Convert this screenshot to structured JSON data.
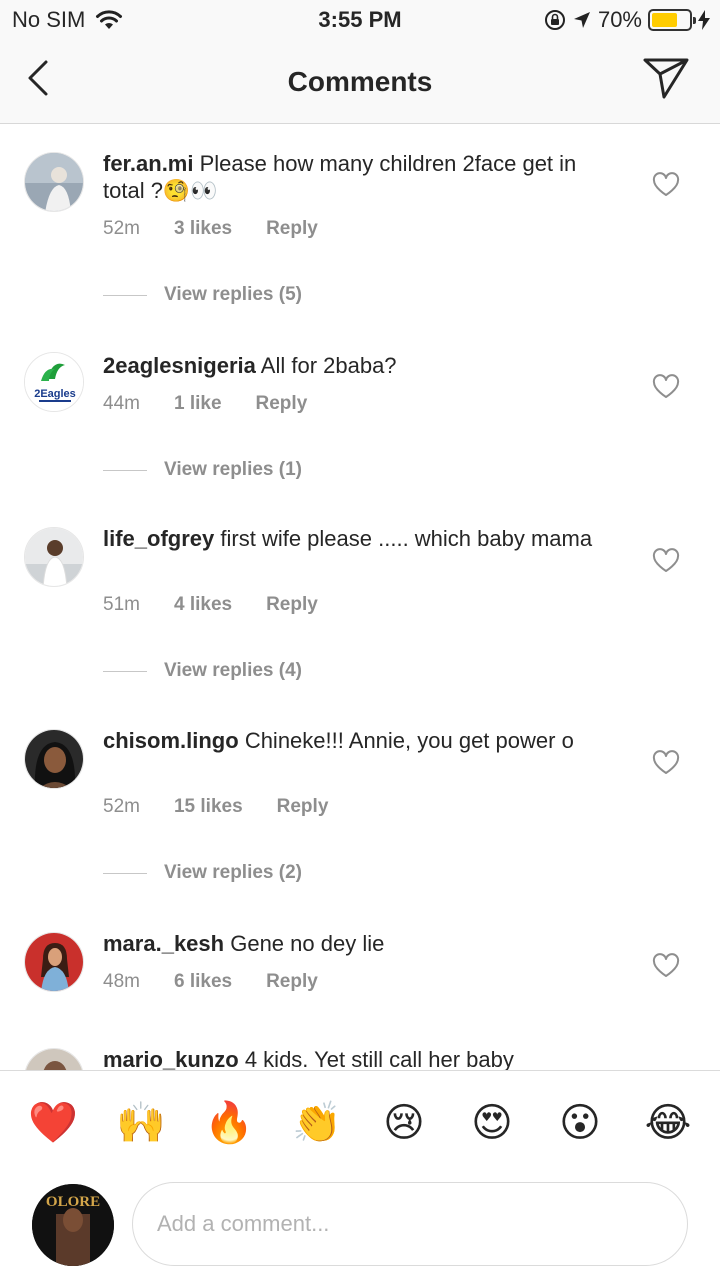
{
  "status_bar": {
    "carrier": "No SIM",
    "time": "3:55 PM",
    "battery_percent": "70%",
    "battery_level": 0.7
  },
  "nav": {
    "title": "Comments"
  },
  "comments": [
    {
      "username": "fer.an.mi",
      "text": "Please how many children 2face get in total ?🧐👀",
      "time": "52m",
      "likes": "3 likes",
      "reply": "Reply",
      "view_replies": "View replies (5)"
    },
    {
      "username": "2eaglesnigeria",
      "text": "All for 2baba?",
      "time": "44m",
      "likes": "1 like",
      "reply": "Reply",
      "view_replies": "View replies (1)",
      "avatar_logo_text": "2Eagles"
    },
    {
      "username": "life_ofgrey",
      "text": "first wife please ..... which baby mama",
      "time": "51m",
      "likes": "4 likes",
      "reply": "Reply",
      "view_replies": "View replies (4)"
    },
    {
      "username": "chisom.lingo",
      "text": "Chineke!!! Annie, you get power o",
      "time": "52m",
      "likes": "15 likes",
      "reply": "Reply",
      "view_replies": "View replies (2)"
    },
    {
      "username": "mara._kesh",
      "text": "Gene no dey lie",
      "time": "48m",
      "likes": "6 likes",
      "reply": "Reply"
    },
    {
      "username": "mario_kunzo",
      "text": "4 kids. Yet still call her baby"
    }
  ],
  "emoji_bar": [
    "❤️",
    "🙌",
    "🔥",
    "👏",
    "😢",
    "😍",
    "😮",
    "😂"
  ],
  "input": {
    "placeholder": "Add a comment..."
  },
  "my_avatar_text": "OLORE",
  "icons": {
    "back": "chevron-left-icon",
    "send": "paper-plane-icon",
    "like": "heart-icon"
  }
}
